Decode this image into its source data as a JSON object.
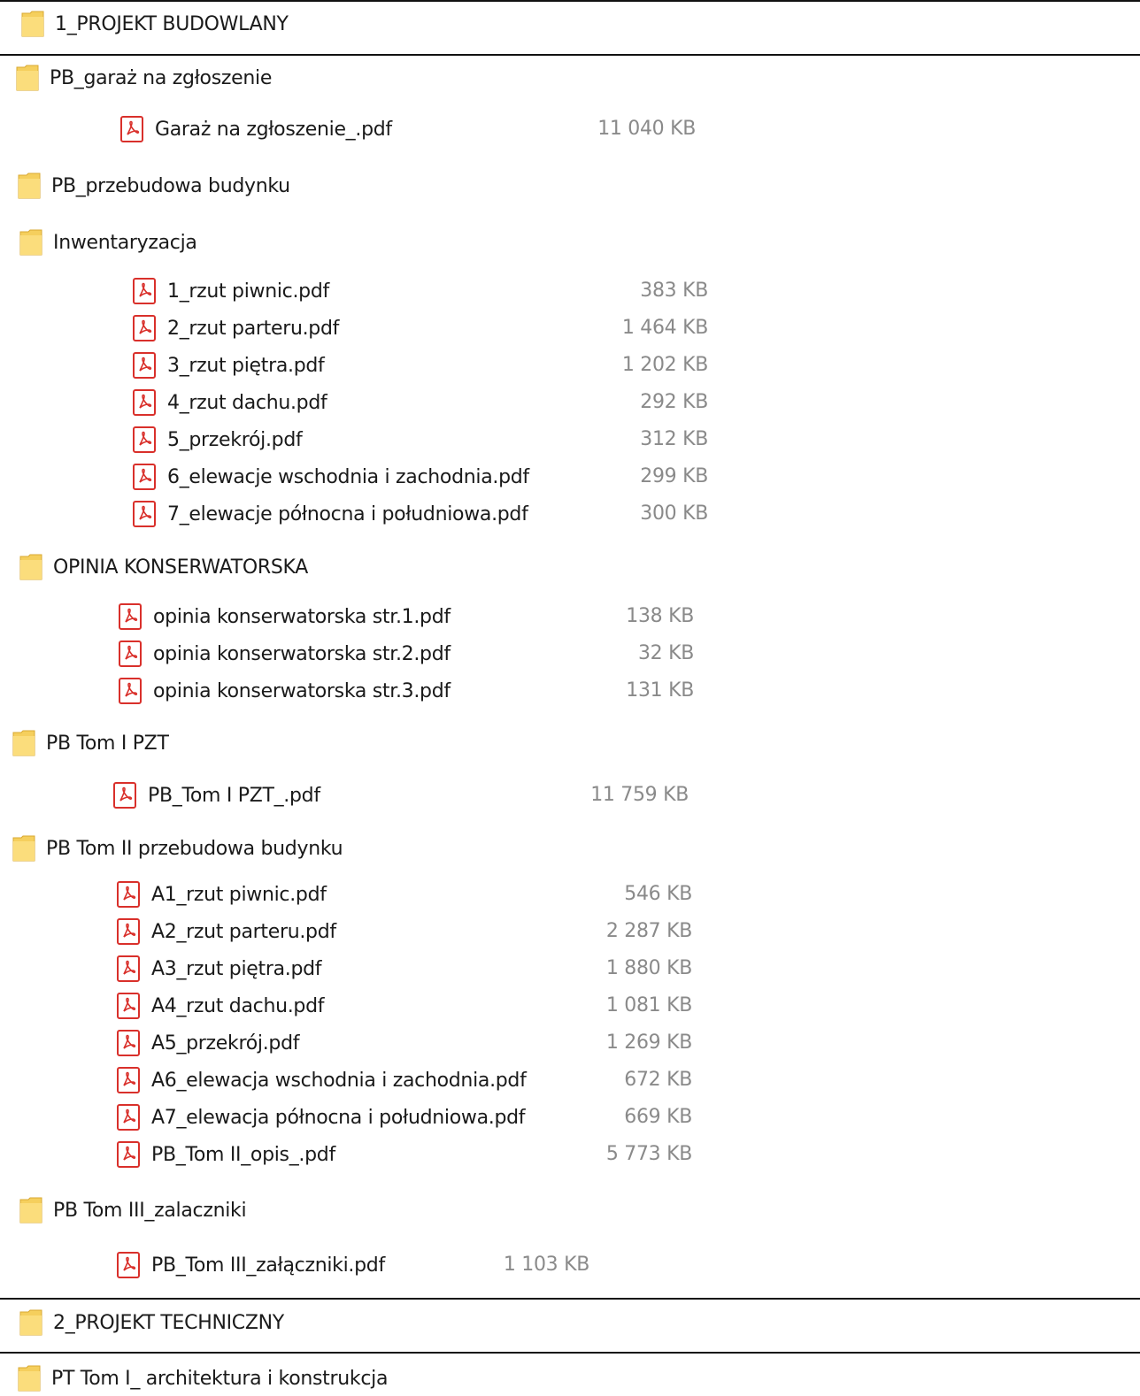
{
  "sections": [
    {
      "name": "1_PROJEKT BUDOWLANY"
    },
    {
      "name": "2_PROJEKT TECHNICZNY"
    }
  ],
  "folders": [
    {
      "name": "PB_garaż na zgłoszenie"
    },
    {
      "name": "PB_przebudowa budynku"
    },
    {
      "name": "Inwentaryzacja"
    },
    {
      "name": "OPINIA KONSERWATORSKA"
    },
    {
      "name": "PB Tom I PZT"
    },
    {
      "name": "PB Tom II przebudowa budynku"
    },
    {
      "name": "PB Tom III_zalaczniki"
    },
    {
      "name": "PT Tom I_ architektura i konstrukcja"
    }
  ],
  "files": [
    {
      "name": "Garaż na zgłoszenie_.pdf",
      "size": "11 040 KB"
    },
    {
      "name": "1_rzut piwnic.pdf",
      "size": "383 KB"
    },
    {
      "name": "2_rzut parteru.pdf",
      "size": "1 464 KB"
    },
    {
      "name": "3_rzut piętra.pdf",
      "size": "1 202 KB"
    },
    {
      "name": "4_rzut dachu.pdf",
      "size": "292 KB"
    },
    {
      "name": "5_przekrój.pdf",
      "size": "312 KB"
    },
    {
      "name": "6_elewacje wschodnia i zachodnia.pdf",
      "size": "299 KB"
    },
    {
      "name": "7_elewacje północna i południowa.pdf",
      "size": "300 KB"
    },
    {
      "name": "opinia konserwatorska str.1.pdf",
      "size": "138 KB"
    },
    {
      "name": "opinia konserwatorska str.2.pdf",
      "size": "32 KB"
    },
    {
      "name": "opinia konserwatorska str.3.pdf",
      "size": "131 KB"
    },
    {
      "name": "PB_Tom I PZT_.pdf",
      "size": "11 759 KB"
    },
    {
      "name": "A1_rzut piwnic.pdf",
      "size": "546 KB"
    },
    {
      "name": "A2_rzut parteru.pdf",
      "size": "2 287 KB"
    },
    {
      "name": "A3_rzut piętra.pdf",
      "size": "1 880 KB"
    },
    {
      "name": "A4_rzut dachu.pdf",
      "size": "1 081 KB"
    },
    {
      "name": "A5_przekrój.pdf",
      "size": "1 269 KB"
    },
    {
      "name": "A6_elewacja wschodnia i zachodnia.pdf",
      "size": "672 KB"
    },
    {
      "name": "A7_elewacja północna i południowa.pdf",
      "size": "669 KB"
    },
    {
      "name": "PB_Tom II_opis_.pdf",
      "size": "5 773 KB"
    },
    {
      "name": "PB_Tom III_załączniki.pdf",
      "size": "1 103 KB"
    }
  ],
  "icons": {
    "folder": "folder-icon",
    "pdf": "pdf-file-icon"
  },
  "colors": {
    "folder": "#f5cf5d",
    "pdf": "#d9302b",
    "size_text": "#8a8a8a"
  }
}
